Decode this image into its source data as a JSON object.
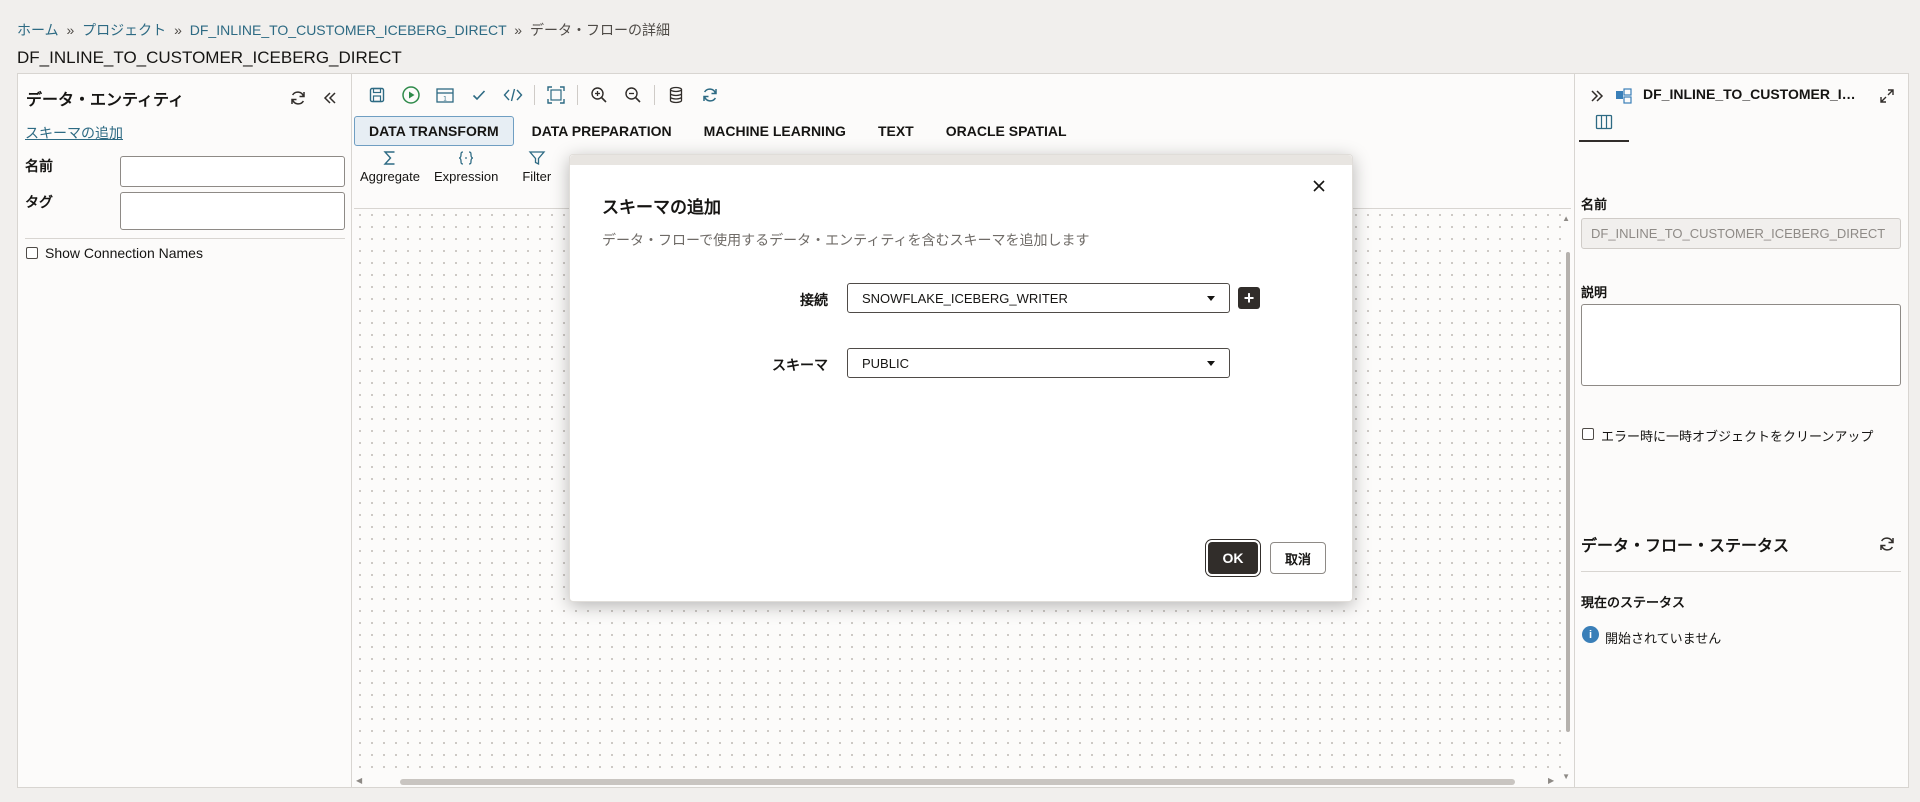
{
  "header": {
    "breadcrumb": {
      "home": "ホーム",
      "project": "プロジェクト",
      "dataflow": "DF_INLINE_TO_CUSTOMER_ICEBERG_DIRECT",
      "current": "データ・フローの詳細",
      "separator": "»"
    },
    "title": "DF_INLINE_TO_CUSTOMER_ICEBERG_DIRECT"
  },
  "left_panel": {
    "title": "データ・エンティティ",
    "add_schema_link": "スキーマの追加",
    "name_label": "名前",
    "name_value": "",
    "tag_label": "タグ",
    "tag_value": "",
    "show_connection_names": "Show Connection Names"
  },
  "canvas": {
    "tabs": [
      "DATA TRANSFORM",
      "DATA PREPARATION",
      "MACHINE LEARNING",
      "TEXT",
      "ORACLE SPATIAL"
    ],
    "active_tab": "DATA TRANSFORM",
    "palette": [
      {
        "label": "Aggregate",
        "icon": "sigma-icon"
      },
      {
        "label": "Expression",
        "icon": "braces-icon"
      },
      {
        "label": "Filter",
        "icon": "filter-icon"
      }
    ]
  },
  "right_panel": {
    "title": "DF_INLINE_TO_CUSTOMER_I…",
    "name_label": "名前",
    "name_value": "DF_INLINE_TO_CUSTOMER_ICEBERG_DIRECT",
    "description_label": "説明",
    "description_value": "",
    "cleanup_checkbox": "エラー時に一時オブジェクトをクリーンアップ",
    "status_title": "データ・フロー・ステータス",
    "current_status_label": "現在のステータス",
    "current_status_value": "開始されていません"
  },
  "dialog": {
    "title": "スキーマの追加",
    "subtitle": "データ・フローで使用するデータ・エンティティを含むスキーマを追加します",
    "connection_label": "接続",
    "connection_value": "SNOWFLAKE_ICEBERG_WRITER",
    "schema_label": "スキーマ",
    "schema_value": "PUBLIC",
    "ok_label": "OK",
    "cancel_label": "取消"
  },
  "colors": {
    "accent_link": "#2d6a83",
    "primary_button": "#312d2a",
    "icon_blue": "#2d6a83",
    "icon_green": "#2e8a4a",
    "info_blue": "#3a7fb8"
  }
}
